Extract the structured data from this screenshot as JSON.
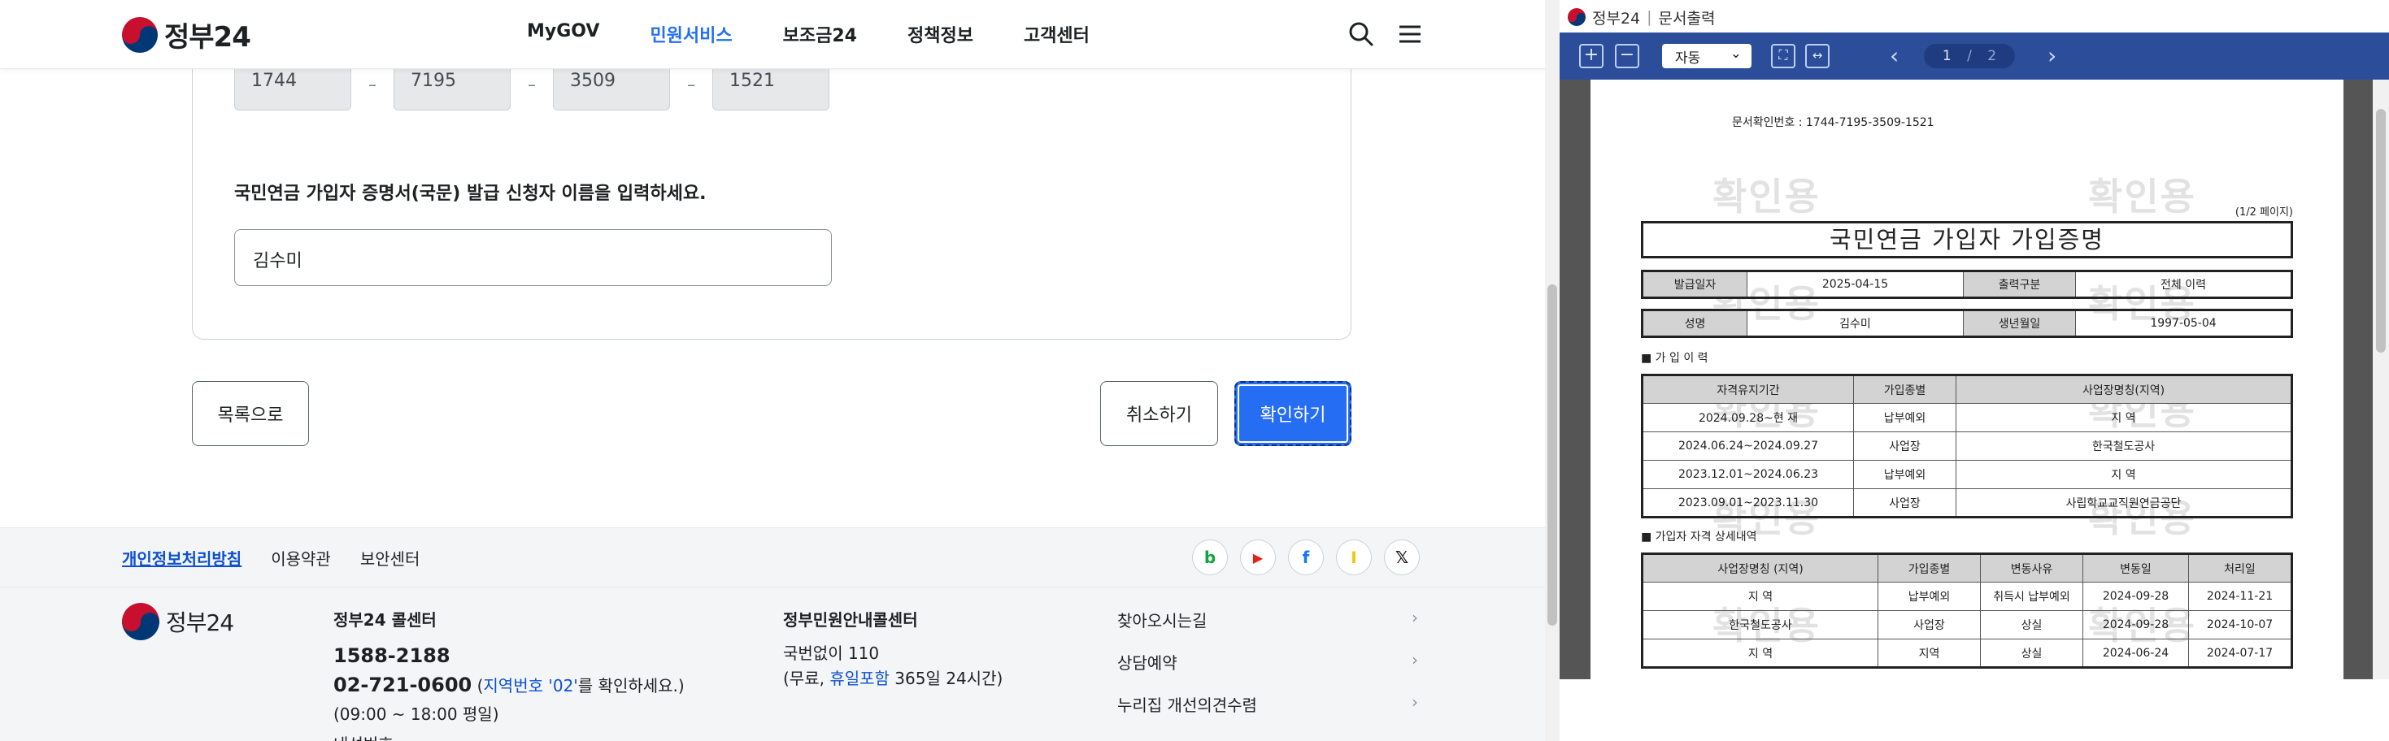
{
  "left": {
    "header": {
      "logo_text": "정부24",
      "nav": [
        "MyGOV",
        "민원서비스",
        "보조금24",
        "정책정보",
        "고객센터"
      ],
      "active_nav": "민원서비스"
    },
    "doc_number_fields": [
      "1744",
      "7195",
      "3509",
      "1521"
    ],
    "dash": "–",
    "name_prompt": "국민연금 가입자 증명서(국문) 발급 신청자 이름을 입력하세요.",
    "name_value": "김수미",
    "buttons": {
      "list": "목록으로",
      "cancel": "취소하기",
      "confirm": "확인하기"
    },
    "footer": {
      "links": [
        "개인정보처리방침",
        "이용약관",
        "보안센터"
      ],
      "logo_text": "정부24",
      "call_center": {
        "title": "정부24 콜센터",
        "phone": "1588-2188",
        "phone2": "02-721-0600",
        "phone2_note_open": " (",
        "phone2_note_link": "지역번호 '02'",
        "phone2_note_close": "를 확인하세요.)",
        "hours": "(09:00 ~ 18:00 평일)",
        "extra": "내선번호"
      },
      "info_center": {
        "title": "정부민원안내콜센터",
        "line1": "국번없이 110",
        "line2_open": "(무료, ",
        "line2_link": "휴일포함",
        "line2_close": " 365일 24시간)"
      },
      "quick_links": [
        "찾아오시는길",
        "상담예약",
        "누리집 개선의견수렴"
      ],
      "sns": [
        "b",
        "▶",
        "f",
        "ⵏ",
        "𝕏"
      ]
    }
  },
  "right": {
    "title_logo": "정부24",
    "title_sep": "|",
    "title": "문서출력",
    "toolbar": {
      "zoom_mode": "자동",
      "page_current": "1",
      "page_sep": "/",
      "page_total": "2"
    },
    "doc": {
      "doc_no": "문서확인번호 : 1744-7195-3509-1521",
      "watermark": "확인용",
      "page_info": "(1/2 페이지)",
      "title": "국민연금 가입자 가입증명",
      "issue_date_label": "발급일자",
      "issue_date": "2025-04-15",
      "print_type_label": "출력구분",
      "print_type": "전체 이력",
      "name_label": "성명",
      "name": "김수미",
      "birth_label": "생년월일",
      "birth": "1997-05-04",
      "history_title": "■ 가 입 이 력",
      "history_headers": [
        "자격유지기간",
        "가입종별",
        "사업장명칭(지역)"
      ],
      "history_rows": [
        [
          "2024.09.28~현 재",
          "납부예외",
          "지 역"
        ],
        [
          "2024.06.24~2024.09.27",
          "사업장",
          "한국철도공사"
        ],
        [
          "2023.12.01~2024.06.23",
          "납부예외",
          "지 역"
        ],
        [
          "2023.09.01~2023.11.30",
          "사업장",
          "사립학교교직원연금공단"
        ]
      ],
      "detail_title": "■ 가입자 자격 상세내역",
      "detail_headers": [
        "사업장명칭 (지역)",
        "가입종별",
        "변동사유",
        "변동일",
        "처리일"
      ],
      "detail_rows": [
        [
          "지 역",
          "납부예외",
          "취득시 납부예외",
          "2024-09-28",
          "2024-11-21"
        ],
        [
          "한국철도공사",
          "사업장",
          "상실",
          "2024-09-28",
          "2024-10-07"
        ],
        [
          "지 역",
          "지역",
          "상실",
          "2024-06-24",
          "2024-07-17"
        ]
      ]
    }
  }
}
